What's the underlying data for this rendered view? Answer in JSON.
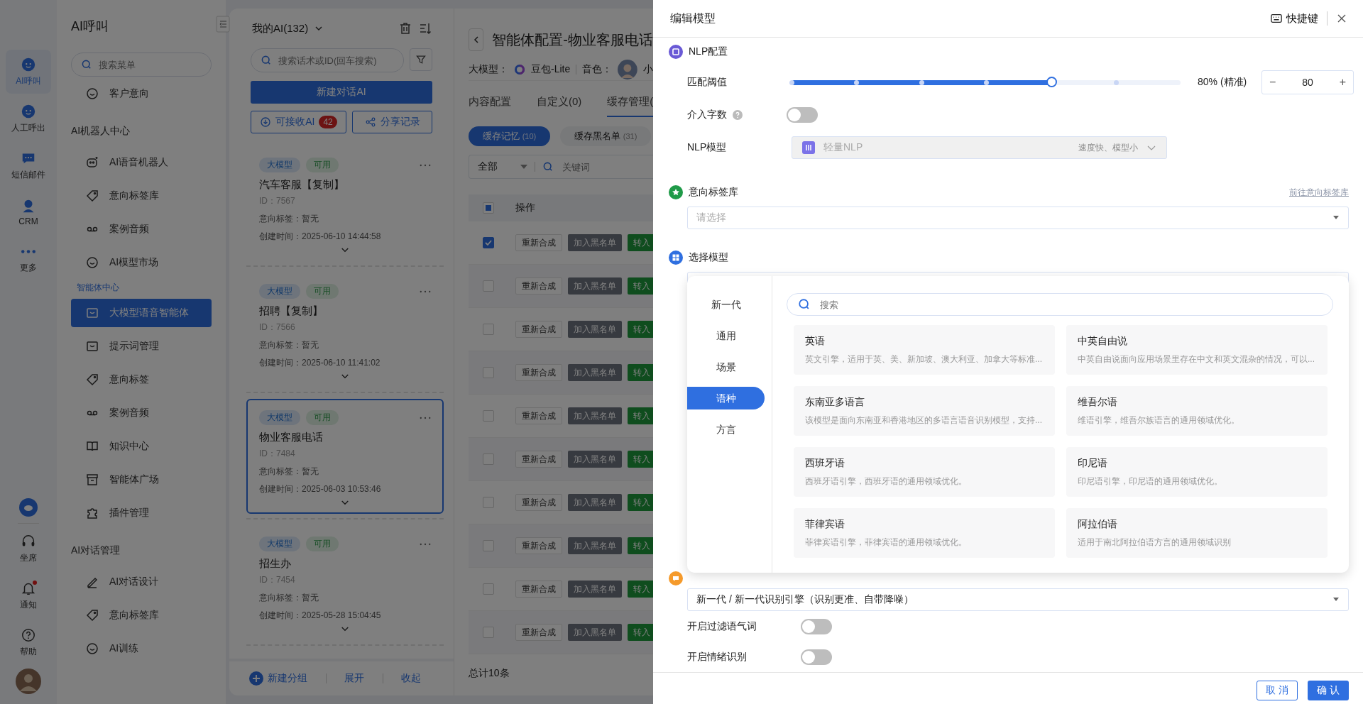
{
  "rail": {
    "items": [
      {
        "label": "AI呼叫",
        "selected": true
      },
      {
        "label": "人工呼出",
        "selected": false
      },
      {
        "label": "短信邮件",
        "selected": false
      },
      {
        "label": "CRM",
        "selected": false
      },
      {
        "label": "更多",
        "selected": false
      }
    ],
    "bottom": [
      {
        "label": "坐席",
        "badge": false
      },
      {
        "label": "通知",
        "badge": true
      },
      {
        "label": "帮助",
        "badge": false
      }
    ]
  },
  "sidebar": {
    "title": "AI呼叫",
    "search": {
      "placeholder": "搜索菜单"
    },
    "groups": [
      {
        "items": [
          {
            "label": "客户意向",
            "selected": false
          }
        ]
      },
      {
        "title": "AI机器人中心",
        "items": [
          {
            "label": "AI语音机器人",
            "selected": false
          },
          {
            "label": "意向标签库",
            "selected": false
          },
          {
            "label": "案例音频",
            "selected": false
          },
          {
            "label": "AI模型市场",
            "selected": false
          }
        ]
      },
      {
        "title": "智能体中心",
        "items": [
          {
            "label": "大模型语音智能体",
            "selected": true
          },
          {
            "label": "提示词管理",
            "selected": false
          },
          {
            "label": "意向标签",
            "selected": false
          },
          {
            "label": "案例音频",
            "selected": false
          },
          {
            "label": "知识中心",
            "selected": false
          },
          {
            "label": "智能体广场",
            "selected": false
          },
          {
            "label": "插件管理",
            "selected": false
          }
        ]
      },
      {
        "title": "AI对话管理",
        "items": [
          {
            "label": "AI对话设计",
            "selected": false
          },
          {
            "label": "意向标签库",
            "selected": false
          },
          {
            "label": "AI训练",
            "selected": false
          }
        ]
      }
    ]
  },
  "agents_panel": {
    "title": "我的AI(132)",
    "search": {
      "placeholder": "搜索话术或ID(回车搜索)"
    },
    "new_button": "新建对话AI",
    "receive_button": {
      "label": "可接收AI",
      "count": "42"
    },
    "share_button": "分享记录",
    "agents": [
      {
        "tags": [
          "大模型",
          "可用"
        ],
        "name": "汽车客服【复制】",
        "id": "ID：7567",
        "intent": "意向标签：暂无",
        "created": "创建时间：2025-06-10 14:44:58",
        "selected": false
      },
      {
        "tags": [
          "大模型",
          "可用"
        ],
        "name": "招聘【复制】",
        "id": "ID：7566",
        "intent": "意向标签：暂无",
        "created": "创建时间：2025-06-10 11:41:02",
        "selected": false
      },
      {
        "tags": [
          "大模型",
          "可用"
        ],
        "name": "物业客服电话",
        "id": "ID：7484",
        "intent": "意向标签：暂无",
        "created": "创建时间：2025-06-03 10:53:46",
        "selected": true
      },
      {
        "tags": [
          "大模型",
          "可用"
        ],
        "name": "招生办",
        "id": "ID：7454",
        "intent": "意向标签：暂无",
        "created": "创建时间：2025-05-28 15:04:45",
        "selected": false
      }
    ],
    "footer": [
      "新建分组",
      "展开",
      "收起"
    ]
  },
  "config": {
    "title": "智能体配置-物业客服电话",
    "model_label": "大模型：",
    "model": "豆包-Lite",
    "voice_label": "音色：",
    "voice": "小",
    "tabs": [
      {
        "label": "内容配置",
        "selected": false
      },
      {
        "label": "自定义(0)",
        "selected": false
      },
      {
        "label": "缓存管理(",
        "selected": true
      }
    ],
    "subtabs": [
      {
        "label": "缓存记忆",
        "count": "(10)",
        "selected": true
      },
      {
        "label": "缓存黑名单",
        "count": "(31)",
        "selected": false
      }
    ],
    "filter": {
      "value": "全部",
      "search_placeholder": "关键词"
    },
    "table": {
      "header_partial": true,
      "column": "操作",
      "rows": [
        {
          "checked": true,
          "actions": [
            "重新合成",
            "加入黑名单",
            "转入"
          ]
        },
        {
          "checked": false,
          "actions": [
            "重新合成",
            "加入黑名单",
            "转入"
          ]
        },
        {
          "checked": false,
          "actions": [
            "重新合成",
            "加入黑名单",
            "转入"
          ]
        },
        {
          "checked": false,
          "actions": [
            "重新合成",
            "加入黑名单",
            "转入"
          ]
        },
        {
          "checked": false,
          "actions": [
            "重新合成",
            "加入黑名单",
            "转入"
          ]
        },
        {
          "checked": false,
          "actions": [
            "重新合成",
            "加入黑名单",
            "转入"
          ]
        },
        {
          "checked": false,
          "actions": [
            "重新合成",
            "加入黑名单",
            "转入"
          ]
        },
        {
          "checked": false,
          "actions": [
            "重新合成",
            "加入黑名单",
            "转入"
          ]
        },
        {
          "checked": false,
          "actions": [
            "重新合成",
            "加入黑名单",
            "转入"
          ]
        },
        {
          "checked": false,
          "actions": [
            "重新合成",
            "加入黑名单",
            "转入"
          ]
        }
      ]
    },
    "total": "总计10条"
  },
  "drawer": {
    "title": "编辑模型",
    "shortcut": "快捷键",
    "nlp": {
      "title": "NLP配置",
      "threshold": {
        "label": "匹配阈值",
        "level": 0.667,
        "reading": "80% (精准)",
        "minus": "−",
        "value": "80",
        "plus": "+"
      },
      "intervene": {
        "label": "介入字数",
        "on": false
      },
      "model": {
        "label": "NLP模型",
        "value": "轻量NLP",
        "hint": "速度快、模型小",
        "disabled": true
      }
    },
    "intent_library": {
      "title": "意向标签库",
      "link": "前往意向标签库",
      "select": {
        "placeholder": "请选择"
      }
    },
    "model_select": {
      "title": "选择模型",
      "popup": {
        "categories": [
          {
            "label": "新一代",
            "selected": false
          },
          {
            "label": "通用",
            "selected": false
          },
          {
            "label": "场景",
            "selected": false
          },
          {
            "label": "语种",
            "selected": true
          },
          {
            "label": "方言",
            "selected": false
          }
        ],
        "search": {
          "placeholder": "搜索"
        },
        "options": [
          {
            "title": "英语",
            "desc": "英文引擎，适用于英、美、新加坡、澳大利亚、加拿大等标准..."
          },
          {
            "title": "中英自由说",
            "desc": "中英自由说面向应用场景里存在中文和英文混杂的情况，可以..."
          },
          {
            "title": "东南亚多语言",
            "desc": "该模型是面向东南亚和香港地区的多语言语音识别模型，支持..."
          },
          {
            "title": "维吾尔语",
            "desc": "维语引擎，维吾尔族语言的通用领域优化。"
          },
          {
            "title": "西班牙语",
            "desc": "西班牙语引擎，西班牙语的通用领域优化。"
          },
          {
            "title": "印尼语",
            "desc": "印尼语引擎，印尼语的通用领域优化。"
          },
          {
            "title": "菲律宾语",
            "desc": "菲律宾语引擎，菲律宾语的通用领域优化。"
          },
          {
            "title": "阿拉伯语",
            "desc": "适用于南北阿拉伯语方言的通用领域识别"
          }
        ]
      }
    },
    "engine": {
      "value": "新一代 / 新一代识别引擎（识别更准、自带降噪）",
      "switches": [
        {
          "label": "开启过滤语气词",
          "on": false
        },
        {
          "label": "开启情绪识别",
          "on": false
        }
      ]
    },
    "footer": {
      "cancel": "取 消",
      "confirm": "确 认"
    }
  }
}
